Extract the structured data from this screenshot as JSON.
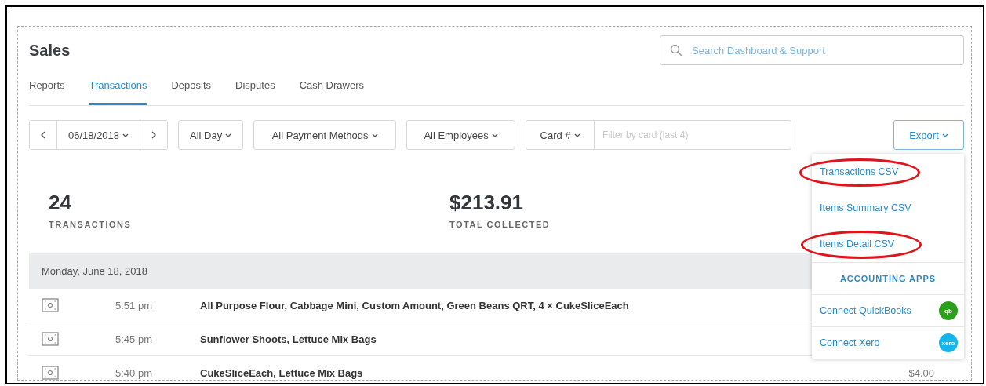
{
  "page_title": "Sales",
  "search": {
    "placeholder": "Search Dashboard & Support"
  },
  "tabs": [
    {
      "label": "Reports",
      "selected": false
    },
    {
      "label": "Transactions",
      "selected": true
    },
    {
      "label": "Deposits",
      "selected": false
    },
    {
      "label": "Disputes",
      "selected": false
    },
    {
      "label": "Cash Drawers",
      "selected": false
    }
  ],
  "filters": {
    "date": "06/18/2018",
    "time": "All Day",
    "payment_methods": "All Payment Methods",
    "employees": "All Employees",
    "card": "Card #",
    "card_filter": {
      "placeholder": "Filter by card (last 4)"
    }
  },
  "export_button": "Export",
  "export_menu": {
    "items": [
      {
        "label": "Transactions CSV",
        "highlighted": true
      },
      {
        "label": "Items Summary CSV",
        "highlighted": false
      },
      {
        "label": "Items Detail CSV",
        "highlighted": true
      }
    ],
    "section_heading": "ACCOUNTING APPS",
    "apps": [
      {
        "label": "Connect QuickBooks",
        "logo": "qb",
        "color": "#2ca01c"
      },
      {
        "label": "Connect Xero",
        "logo": "xero",
        "color": "#13b5ea"
      }
    ]
  },
  "stats": [
    {
      "value": "24",
      "label": "TRANSACTIONS"
    },
    {
      "value": "$213.91",
      "label": "TOTAL COLLECTED"
    }
  ],
  "day": {
    "date": "Monday, June 18, 2018",
    "rows": [
      {
        "time": "5:51 pm",
        "description": "All Purpose Flour, Cabbage Mini, Custom Amount, Green Beans QRT, 4 × CukeSliceEach"
      },
      {
        "time": "5:45 pm",
        "description": "Sunflower Shoots, Lettuce Mix Bags"
      },
      {
        "time": "5:40 pm",
        "description": "CukeSliceEach, Lettuce Mix Bags",
        "amount": "$4.00"
      }
    ]
  }
}
